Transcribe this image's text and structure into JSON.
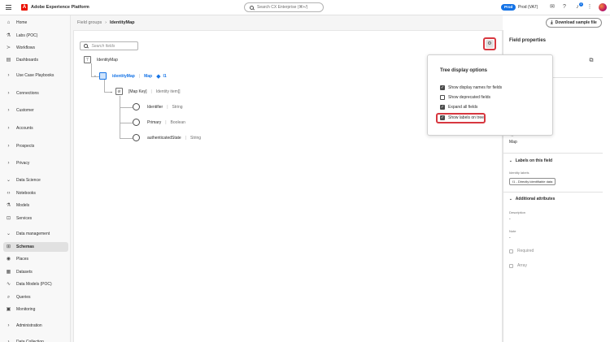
{
  "header": {
    "logo_letter": "A",
    "app_title": "Adobe Experience Platform",
    "search_placeholder": "Search CX Enterprise (⌘+/)",
    "env_badge": "Prod",
    "env_name": "Prod (VA7)",
    "notification_count": "1"
  },
  "sidebar": {
    "items": [
      {
        "label": "Home",
        "icon": "home-icon",
        "glyph": "⌂"
      },
      {
        "label": "Labs (POC)",
        "icon": "flask-icon",
        "glyph": "⚗"
      },
      {
        "label": "Workflows",
        "icon": "workflow-icon",
        "glyph": "≻"
      },
      {
        "label": "Dashboards",
        "icon": "dashboard-icon",
        "glyph": "▤"
      },
      {
        "label": "Use Case Playbooks",
        "icon": "chevron-right-icon",
        "glyph": "›"
      },
      {
        "label": "Connections",
        "icon": "chevron-right-icon",
        "glyph": "›"
      },
      {
        "label": "Customer",
        "icon": "chevron-right-icon",
        "glyph": "›"
      },
      {
        "label": "Accounts",
        "icon": "chevron-right-icon",
        "glyph": "›"
      },
      {
        "label": "Prospects",
        "icon": "chevron-right-icon",
        "glyph": "›"
      },
      {
        "label": "Privacy",
        "icon": "chevron-right-icon",
        "glyph": "›"
      },
      {
        "label": "Data Science",
        "icon": "chevron-down-icon",
        "glyph": "⌄"
      },
      {
        "label": "Notebooks",
        "icon": "code-icon",
        "glyph": "‹›"
      },
      {
        "label": "Models",
        "icon": "flask-icon",
        "glyph": "⚗"
      },
      {
        "label": "Services",
        "icon": "services-icon",
        "glyph": "⊡"
      },
      {
        "label": "Data management",
        "icon": "chevron-down-icon",
        "glyph": "⌄"
      },
      {
        "label": "Schemas",
        "icon": "schema-icon",
        "glyph": "⊞"
      },
      {
        "label": "Places",
        "icon": "location-icon",
        "glyph": "◉"
      },
      {
        "label": "Datasets",
        "icon": "dataset-icon",
        "glyph": "▦"
      },
      {
        "label": "Data Models (POC)",
        "icon": "model-icon",
        "glyph": "∿"
      },
      {
        "label": "Queries",
        "icon": "query-icon",
        "glyph": "⌕"
      },
      {
        "label": "Monitoring",
        "icon": "monitoring-icon",
        "glyph": "▣"
      },
      {
        "label": "Administration",
        "icon": "chevron-right-icon",
        "glyph": "›"
      },
      {
        "label": "Data Collection",
        "icon": "chevron-right-icon",
        "glyph": "›"
      }
    ],
    "active_index": 15
  },
  "breadcrumb": {
    "parent": "Field groups",
    "current": "IdentityMap"
  },
  "toolbar": {
    "download_label": "Download sample file"
  },
  "canvas": {
    "search_placeholder": "Search fields"
  },
  "tree": {
    "root_label": "IdentityMap",
    "map_field": "identityMap",
    "map_type": "Map",
    "map_tag": "I1",
    "map_key": "[Map Key]",
    "map_item": "Identity item[]",
    "leaves": [
      {
        "name": "Identifier",
        "type": "String"
      },
      {
        "name": "Primary",
        "type": "Boolean"
      },
      {
        "name": "authenticatedState",
        "type": "String"
      }
    ]
  },
  "popover": {
    "title": "Tree display options",
    "options": [
      {
        "label": "Show display names for fields",
        "checked": true
      },
      {
        "label": "Show deprecated fields",
        "checked": false
      },
      {
        "label": "Expand all fields",
        "checked": true
      },
      {
        "label": "Show labels on tree",
        "checked": true
      }
    ]
  },
  "field_properties": {
    "title": "Field properties",
    "type_label": "Type",
    "type_value": "Map",
    "labels_section": "Labels on this field",
    "identity_labels_caption": "Identity labels",
    "identity_chip": "I1 - Directly identifiable data",
    "additional_section": "Additional attributes",
    "description_label": "Description",
    "description_value": "-",
    "note_label": "Note",
    "note_value": "-",
    "required_label": "Required",
    "array_label": "Array"
  },
  "colors": {
    "accent_blue": "#1473e6",
    "highlight_red": "#d7373f",
    "adobe_red": "#eb1000"
  }
}
